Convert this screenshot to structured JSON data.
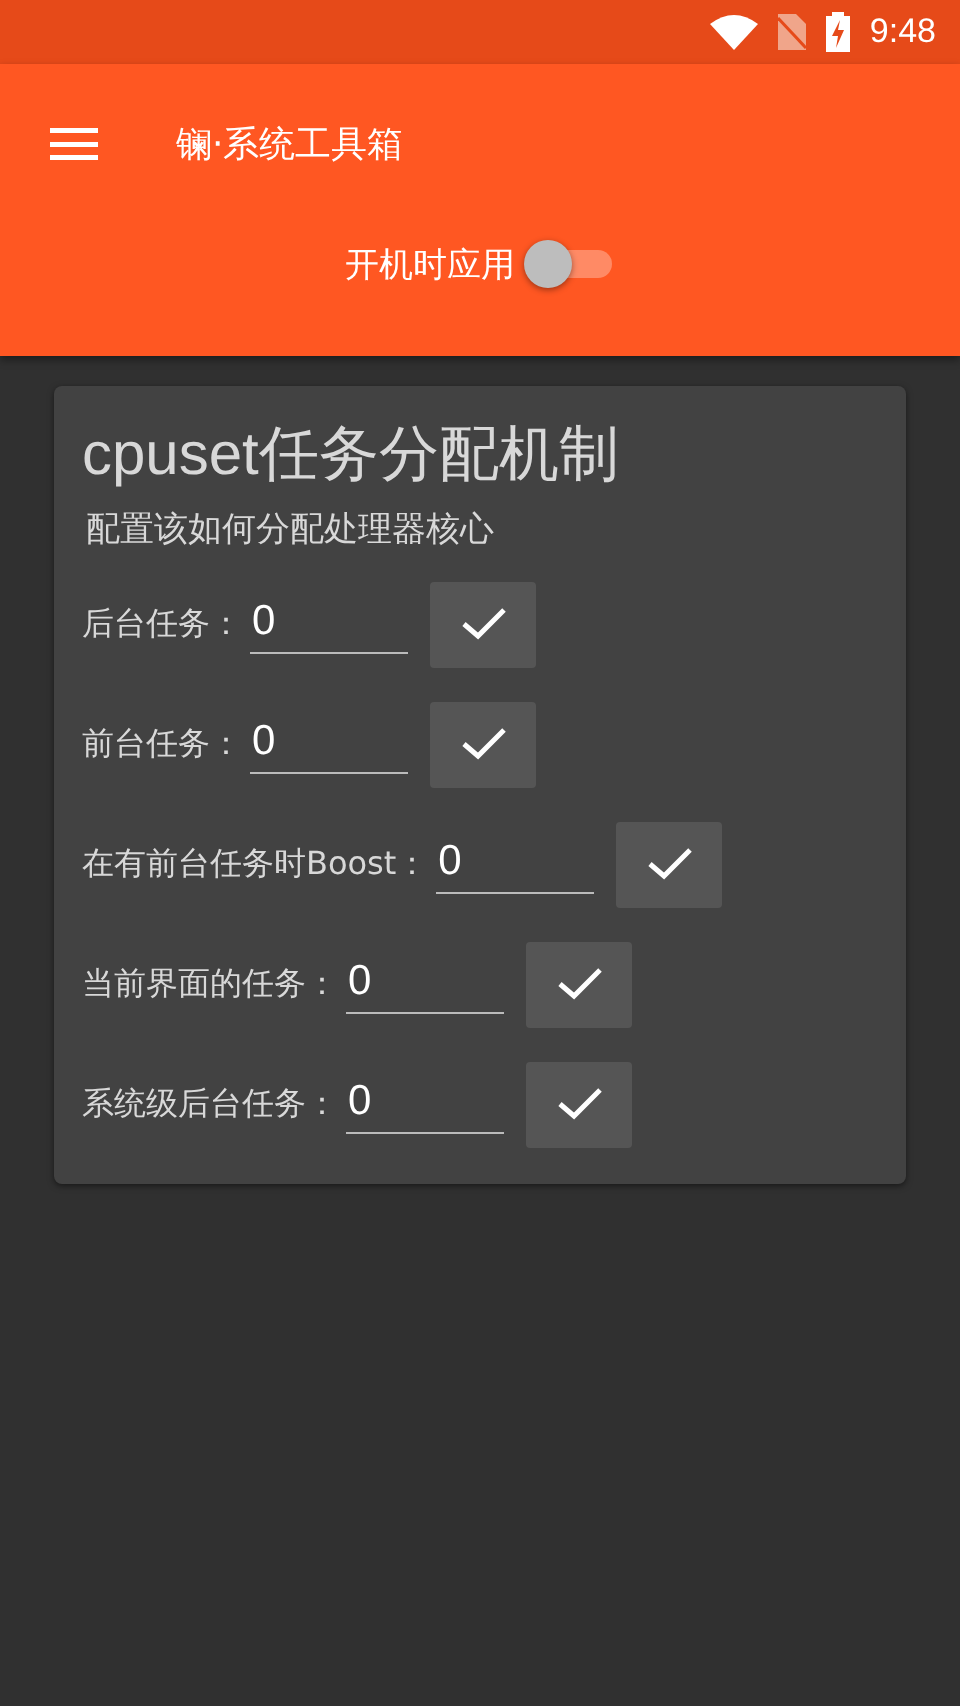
{
  "status_bar": {
    "time": "9:48"
  },
  "toolbar": {
    "title": "镧·系统工具箱"
  },
  "boot_switch": {
    "label": "开机时应用",
    "on": false
  },
  "card": {
    "title": "cpuset任务分配机制",
    "subtitle": "配置该如何分配处理器核心",
    "rows": [
      {
        "label": "后台任务：",
        "value": "0"
      },
      {
        "label": "前台任务：",
        "value": "0"
      },
      {
        "label": "在有前台任务时Boost：",
        "value": "0"
      },
      {
        "label": "当前界面的任务：",
        "value": "0"
      },
      {
        "label": "系统级后台任务：",
        "value": "0"
      }
    ]
  }
}
